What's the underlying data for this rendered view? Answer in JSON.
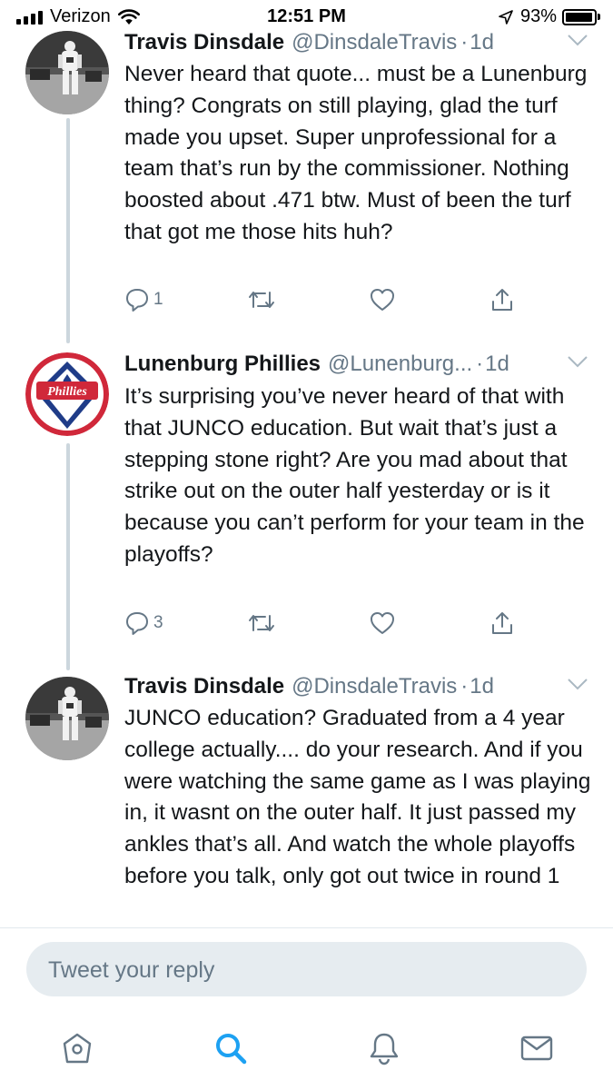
{
  "status_bar": {
    "carrier": "Verizon",
    "time": "12:51 PM",
    "battery": "93%",
    "battery_level": 0.93,
    "icons": [
      "signal-icon",
      "wifi-icon",
      "location-arrow-icon",
      "battery-icon"
    ]
  },
  "tweets": [
    {
      "name": "Travis Dinsdale",
      "handle": "@DinsdaleTravis",
      "separator": "·",
      "time": "1d",
      "text": "Never heard that quote... must be a Lunenburg thing? Congrats on still playing, glad the turf made you upset. Super unprofessional for a team that’s run by the commissioner. Nothing boosted about .471 btw. Must of been the turf that got me those hits huh?",
      "reply_count": "1",
      "avatar": "player-photo"
    },
    {
      "name": "Lunenburg Phillies",
      "handle": "@Lunenburg...",
      "separator": "·",
      "time": "1d",
      "text": "It’s surprising you’ve never heard of that with that JUNCO education. But wait that’s just a stepping stone right? Are you mad about that strike out on the outer half yesterday or is it because you can’t perform for your team in the playoffs?",
      "reply_count": "3",
      "avatar": "phillies-logo",
      "avatar_logo_text": "Phillies"
    },
    {
      "name": "Travis Dinsdale",
      "handle": "@DinsdaleTravis",
      "separator": "·",
      "time": "1d",
      "text": "JUNCO education? Graduated from a 4 year college actually.... do your research. And if you were watching the same game as I was playing in, it wasnt on the outer half. It just passed my ankles that’s all. And watch the whole playoffs before you talk, only got out twice in round 1",
      "avatar": "player-photo"
    }
  ],
  "reply": {
    "placeholder": "Tweet your reply"
  },
  "tab_bar": {
    "tabs": [
      "home-icon",
      "search-icon",
      "notifications-icon",
      "messages-icon"
    ],
    "active": "search-icon"
  },
  "colors": {
    "text": "#14171a",
    "secondary": "#657786",
    "accent": "#1da1f2",
    "thread_line": "#ccd6dd",
    "reply_bg": "#e6ecf0",
    "phillies_red": "#d0283a",
    "phillies_blue": "#1f3c88"
  }
}
